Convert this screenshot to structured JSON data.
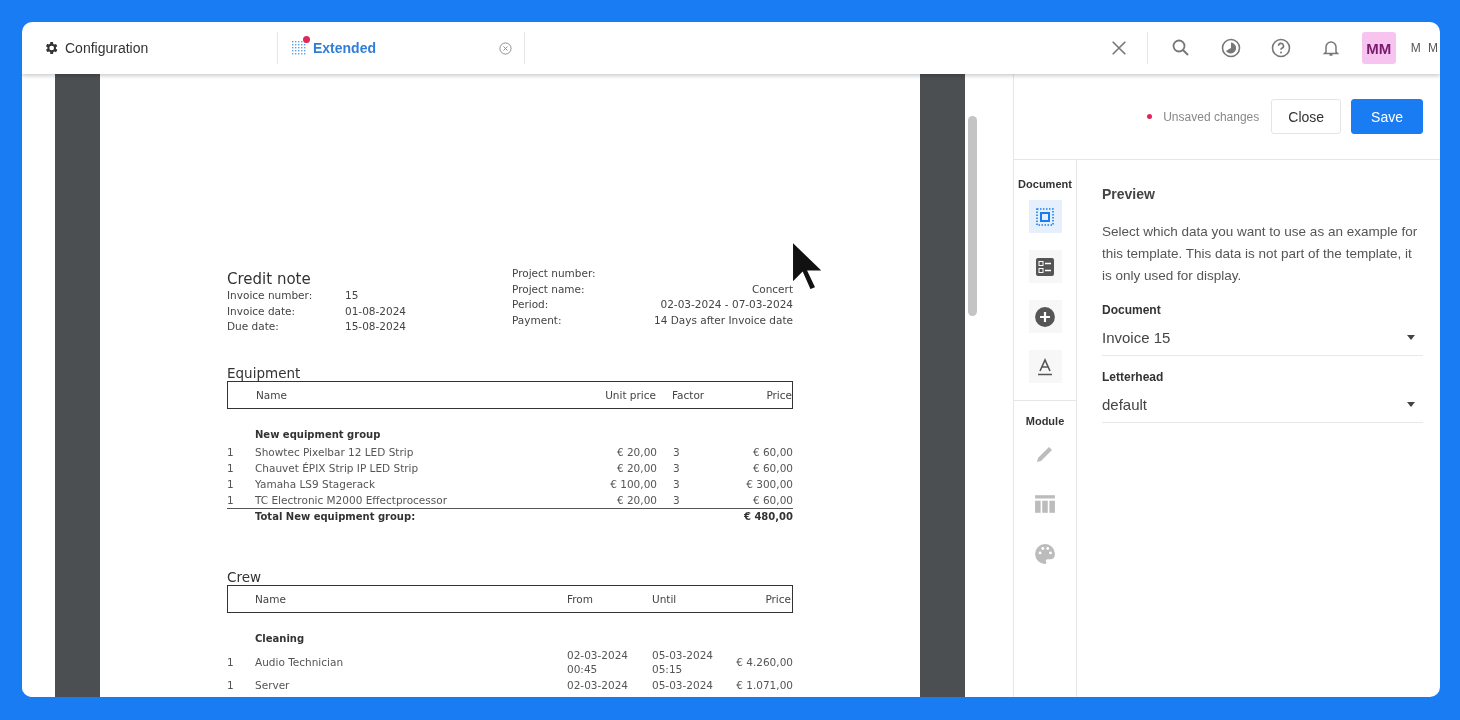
{
  "tabs": [
    {
      "label": "Configuration",
      "selected": false,
      "unsaved": false,
      "closable": false
    },
    {
      "label": "Extended",
      "selected": true,
      "unsaved": true,
      "closable": true
    }
  ],
  "user": {
    "initials": "MM",
    "name": "M M"
  },
  "document": {
    "title": "Credit note",
    "info_left": [
      {
        "label": "Invoice number:",
        "value": "15"
      },
      {
        "label": "Invoice date:",
        "value": "01-08-2024"
      },
      {
        "label": "Due date:",
        "value": "15-08-2024"
      }
    ],
    "info_right": [
      {
        "label": "Project number:"
      },
      {
        "label": "Project name:",
        "value": "Concert"
      },
      {
        "label": "Period:",
        "value": "02-03-2024 - 07-03-2024"
      },
      {
        "label": "Payment:",
        "value": "14 Days after Invoice date"
      }
    ],
    "equipment": {
      "title": "Equipment",
      "columns": [
        "",
        "Name",
        "Unit price",
        "Factor",
        "Price"
      ],
      "group": "New equipment group",
      "rows": [
        [
          "1",
          "Showtec Pixelbar 12 LED Strip",
          "€ 20,00",
          "3",
          "€ 60,00"
        ],
        [
          "1",
          "Chauvet ÉPIX Strip IP LED Strip",
          "€ 20,00",
          "3",
          "€ 60,00"
        ],
        [
          "1",
          "Yamaha LS9 Stagerack",
          "€ 100,00",
          "3",
          "€ 300,00"
        ],
        [
          "1",
          "TC Electronic M2000 Effectprocessor",
          "€ 20,00",
          "3",
          "€ 60,00"
        ]
      ],
      "total_label": "Total New equipment group:",
      "total": "€ 480,00"
    },
    "crew": {
      "title": "Crew",
      "columns": [
        "",
        "Name",
        "From",
        "Until",
        "Price"
      ],
      "group": "Cleaning",
      "rows": [
        [
          "1",
          "Audio Technician",
          "02-03-2024 00:45",
          "05-03-2024 05:15",
          "€ 4.260,00"
        ],
        [
          "1",
          "Server",
          "02-03-2024",
          "05-03-2024",
          "€ 1.071,00"
        ]
      ]
    }
  },
  "editor": {
    "status": "Unsaved changes",
    "buttons": [
      {
        "label": "Close",
        "kind": "secondary"
      },
      {
        "label": "Save",
        "kind": "primary"
      }
    ],
    "rail": [
      {
        "title": "Document",
        "items": [
          {
            "kind": "frame",
            "selected": true,
            "disabled": false
          },
          {
            "kind": "list",
            "selected": false,
            "disabled": false
          },
          {
            "kind": "add",
            "selected": false,
            "disabled": false
          },
          {
            "kind": "text",
            "selected": false,
            "disabled": false
          }
        ]
      },
      {
        "title": "Module",
        "items": [
          {
            "kind": "pencil",
            "selected": false,
            "disabled": true
          },
          {
            "kind": "table",
            "selected": false,
            "disabled": true
          },
          {
            "kind": "palette",
            "selected": false,
            "disabled": true
          }
        ]
      }
    ],
    "heading": "Preview",
    "description": "Select which data you want to use as an example for this template. This data is not part of the template, it is only used for display.",
    "fields": [
      {
        "label": "Document",
        "value": "Invoice 15"
      },
      {
        "label": "Letterhead",
        "value": "default"
      }
    ]
  }
}
